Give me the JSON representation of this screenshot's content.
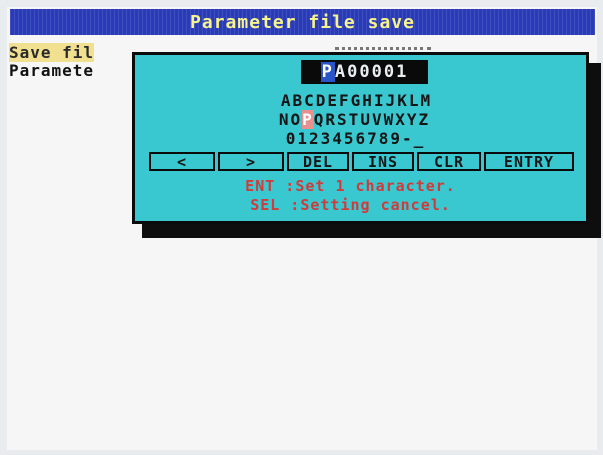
{
  "title": "Parameter file save",
  "background": {
    "line1": "Save fil",
    "line2": "Paramete"
  },
  "dialog": {
    "filename_cursor_char": "P",
    "filename_rest": "A00001",
    "keyboard": {
      "row1": "ABCDEFGHIJKLM",
      "row2_before": "NO",
      "row2_selected": "P",
      "row2_after": "QRSTUVWXYZ",
      "row3": "0123456789-_"
    },
    "buttons": {
      "left": "<",
      "right": ">",
      "del": "DEL",
      "ins": "INS",
      "clr": "CLR",
      "entry": "ENTRY"
    },
    "help": {
      "line1": "ENT :Set 1 character.",
      "line2": "SEL :Setting cancel."
    }
  },
  "colors": {
    "title_bg": "#2a3bb8",
    "title_text": "#f6f48a",
    "dialog_bg": "#39c7d0",
    "help_text": "#d23a3a",
    "key_highlight": "#e89090"
  }
}
